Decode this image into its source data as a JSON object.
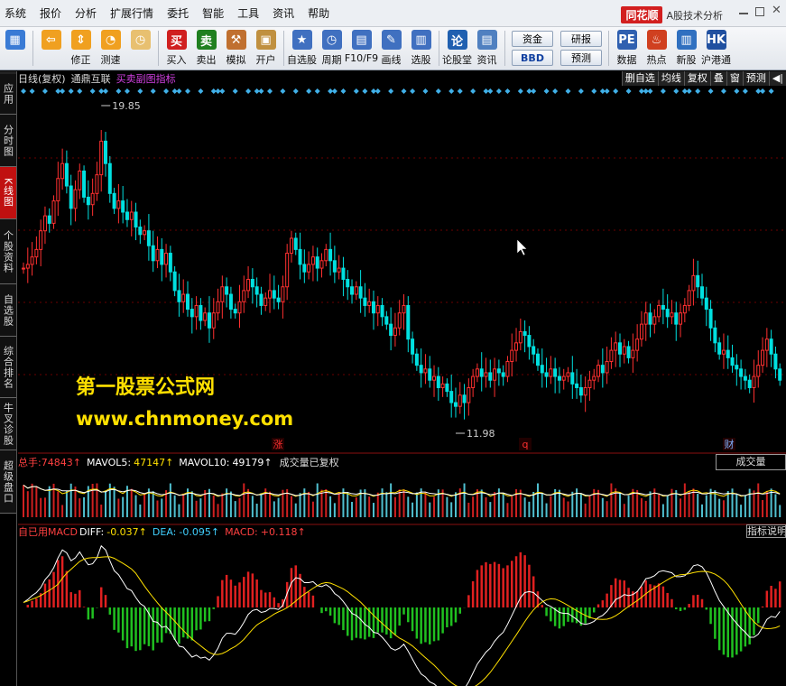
{
  "menu": [
    "系统",
    "报价",
    "分析",
    "扩展行情",
    "委托",
    "智能",
    "工具",
    "资讯",
    "帮助"
  ],
  "brand": {
    "logo": "同花顺",
    "subtitle": "A股技术分析"
  },
  "toolbar": {
    "buttons": [
      {
        "label": "",
        "icon": "grid-icon",
        "color": "#3a7bd5"
      },
      {
        "label": "",
        "icon": "back-arrow-icon",
        "color": "#f0a020"
      },
      {
        "label": "修正",
        "icon": "up-down-icon",
        "color": "#f0a020"
      },
      {
        "label": "测速",
        "icon": "speed-icon",
        "color": "#f0a020"
      },
      {
        "label": "",
        "icon": "clock-icon",
        "color": "#e8c070"
      },
      {
        "label": "买入",
        "icon": "buy-icon",
        "color": "#d02020",
        "text": "买"
      },
      {
        "label": "卖出",
        "icon": "sell-icon",
        "color": "#208020",
        "text": "卖"
      },
      {
        "label": "模拟",
        "icon": "hammer-icon",
        "color": "#c07030"
      },
      {
        "label": "开户",
        "icon": "lock-icon",
        "color": "#c09040"
      },
      {
        "label": "自选股",
        "icon": "star-icon",
        "color": "#4070c0"
      },
      {
        "label": "周期",
        "icon": "period-icon",
        "color": "#4070c0"
      },
      {
        "label": "F10/F9",
        "icon": "f10-icon",
        "color": "#4070c0"
      },
      {
        "label": "画线",
        "icon": "pen-icon",
        "color": "#4070c0"
      },
      {
        "label": "选股",
        "icon": "select-stock-icon",
        "color": "#4070c0"
      },
      {
        "label": "论股堂",
        "icon": "forum-icon",
        "color": "#2060b0",
        "text": "论"
      },
      {
        "label": "资讯",
        "icon": "news-icon",
        "color": "#5080c0"
      }
    ],
    "pairs": [
      [
        "资金",
        "BBD"
      ],
      [
        "研报",
        "预测"
      ]
    ],
    "right_buttons": [
      {
        "label": "数据",
        "icon": "pe-icon",
        "color": "#3060b0",
        "text": "PE"
      },
      {
        "label": "热点",
        "icon": "hot-icon",
        "color": "#d04020"
      },
      {
        "label": "新股",
        "icon": "new-stock-icon",
        "color": "#3070c0"
      },
      {
        "label": "沪港通",
        "icon": "hk-connect-icon",
        "color": "#2050a0",
        "text": "HK"
      }
    ]
  },
  "sidebar": [
    "应用",
    "分时图",
    "K线图",
    "个股资料",
    "自选股",
    "综合排名",
    "牛叉诊股",
    "超级盘口"
  ],
  "header": {
    "period": "日线(复权)",
    "stock": "通鼎互联",
    "indicator": "买卖副图指标",
    "buttons": [
      "删自选",
      "均线",
      "复权",
      "叠",
      "窗",
      "预测"
    ]
  },
  "price": {
    "high_label": "19.85",
    "low_label": "11.98",
    "markers": [
      {
        "text": "涨",
        "color": "#ff3030"
      },
      {
        "text": "q",
        "color": "#ff3030"
      },
      {
        "text": "财",
        "color": "#80b0ff"
      }
    ]
  },
  "watermark": {
    "line1": "第一股票公式网",
    "line2": "www.chnmoney.com"
  },
  "volume": {
    "total_label": "总手:",
    "total_value": "74843↑",
    "mavol5_label": "MAVOL5:",
    "mavol5_value": "47147↑",
    "mavol10_label": "MAVOL10:",
    "mavol10_value": "49179↑",
    "note": "成交量已复权",
    "box": "成交量"
  },
  "macd": {
    "title": "自已用MACD",
    "diff_label": "DIFF:",
    "diff_value": "-0.037↑",
    "dea_label": "DEA:",
    "dea_value": "-0.095↑",
    "macd_label": "MACD:",
    "macd_value": "+0.118↑",
    "box": "指标说明"
  },
  "colors": {
    "up": "#ff3030",
    "down": "#00e0e0",
    "macd_up": "#e02020",
    "macd_down": "#20c020",
    "volume_up": "#d02020",
    "volume_down": "#50c0d0"
  },
  "chart_data": {
    "type": "candlestick",
    "price_high": 19.85,
    "price_low": 11.98,
    "closes": [
      15.8,
      15.9,
      16.1,
      16.3,
      16.8,
      17.2,
      17.0,
      17.6,
      18.2,
      18.6,
      18.0,
      17.4,
      17.9,
      18.4,
      17.7,
      17.5,
      17.8,
      18.3,
      19.2,
      18.6,
      17.8,
      17.4,
      17.6,
      17.3,
      17.1,
      17.3,
      16.9,
      16.7,
      16.8,
      16.4,
      16.0,
      16.3,
      15.9,
      16.2,
      15.7,
      15.2,
      14.9,
      15.1,
      14.7,
      14.5,
      14.8,
      14.4,
      14.6,
      14.2,
      14.6,
      14.9,
      15.3,
      15.1,
      14.7,
      14.6,
      14.9,
      15.2,
      15.5,
      15.3,
      15.1,
      14.8,
      15.0,
      15.2,
      15.0,
      14.9,
      15.3,
      16.2,
      16.6,
      16.3,
      15.9,
      15.7,
      15.9,
      16.1,
      15.8,
      16.0,
      16.3,
      16.0,
      15.7,
      15.8,
      15.5,
      15.3,
      15.1,
      15.3,
      15.0,
      14.8,
      14.9,
      14.6,
      14.8,
      14.5,
      14.3,
      14.0,
      14.2,
      14.6,
      14.8,
      13.9,
      13.5,
      13.2,
      13.0,
      13.1,
      12.8,
      12.9,
      12.6,
      12.7,
      12.5,
      12.2,
      12.1,
      12.4,
      12.2,
      12.6,
      12.9,
      13.1,
      12.9,
      13.0,
      12.8,
      13.1,
      13.0,
      12.9,
      13.3,
      13.6,
      13.8,
      14.1,
      14.0,
      13.7,
      13.5,
      13.2,
      13.0,
      12.9,
      13.1,
      12.9,
      12.8,
      12.9,
      13.0,
      12.7,
      12.6,
      12.4,
      12.6,
      12.8,
      12.9,
      13.2,
      13.0,
      13.3,
      13.6,
      13.8,
      13.5,
      13.7,
      13.4,
      13.6,
      13.9,
      14.3,
      14.6,
      14.3,
      14.5,
      14.8,
      14.7,
      14.5,
      14.6,
      14.3,
      14.6,
      14.8,
      15.2,
      15.6,
      15.3,
      15.0,
      14.7,
      14.2,
      13.8,
      13.5,
      13.6,
      13.4,
      13.2,
      13.1,
      12.9,
      12.8,
      12.6,
      12.9,
      13.2,
      13.6,
      13.9,
      13.5,
      13.1,
      12.8
    ],
    "diff": [
      0.05,
      0.08,
      0.12,
      0.15,
      0.2,
      0.28,
      0.33,
      0.4,
      0.5,
      0.58,
      0.55,
      0.47,
      0.5,
      0.56,
      0.49,
      0.43,
      0.44,
      0.5,
      0.62,
      0.58,
      0.47,
      0.37,
      0.33,
      0.26,
      0.19,
      0.17,
      0.1,
      0.04,
      0.01,
      -0.06,
      -0.14,
      -0.15,
      -0.2,
      -0.19,
      -0.24,
      -0.32,
      -0.39,
      -0.4,
      -0.45,
      -0.5,
      -0.48,
      -0.51,
      -0.5,
      -0.53,
      -0.48,
      -0.41,
      -0.31,
      -0.26,
      -0.26,
      -0.27,
      -0.22,
      -0.15,
      -0.07,
      -0.03,
      -0.02,
      -0.05,
      -0.04,
      -0.01,
      -0.01,
      -0.02,
      0.02,
      0.14,
      0.25,
      0.3,
      0.29,
      0.25,
      0.25,
      0.26,
      0.22,
      0.21,
      0.23,
      0.2,
      0.14,
      0.11,
      0.06,
      0.0,
      -0.06,
      -0.08,
      -0.12,
      -0.17,
      -0.2,
      -0.25,
      -0.26,
      -0.3,
      -0.35,
      -0.41,
      -0.43,
      -0.41,
      -0.37,
      -0.44,
      -0.52,
      -0.6,
      -0.67,
      -0.7,
      -0.75,
      -0.77,
      -0.81,
      -0.82,
      -0.83,
      -0.86,
      -0.87,
      -0.84,
      -0.82,
      -0.75,
      -0.66,
      -0.57,
      -0.51,
      -0.45,
      -0.41,
      -0.34,
      -0.29,
      -0.25,
      -0.17,
      -0.08,
      0.01,
      0.1,
      0.15,
      0.16,
      0.15,
      0.11,
      0.07,
      0.03,
      0.01,
      -0.02,
      -0.05,
      -0.06,
      -0.06,
      -0.09,
      -0.12,
      -0.16,
      -0.17,
      -0.16,
      -0.14,
      -0.1,
      -0.08,
      -0.04,
      0.02,
      0.08,
      0.1,
      0.13,
      0.12,
      0.13,
      0.16,
      0.22,
      0.29,
      0.3,
      0.32,
      0.36,
      0.37,
      0.36,
      0.35,
      0.31,
      0.31,
      0.32,
      0.36,
      0.42,
      0.43,
      0.41,
      0.35,
      0.26,
      0.16,
      0.07,
      0.01,
      -0.05,
      -0.11,
      -0.16,
      -0.21,
      -0.25,
      -0.3,
      -0.3,
      -0.27,
      -0.2,
      -0.12,
      -0.09,
      -0.1,
      -0.04
    ]
  }
}
